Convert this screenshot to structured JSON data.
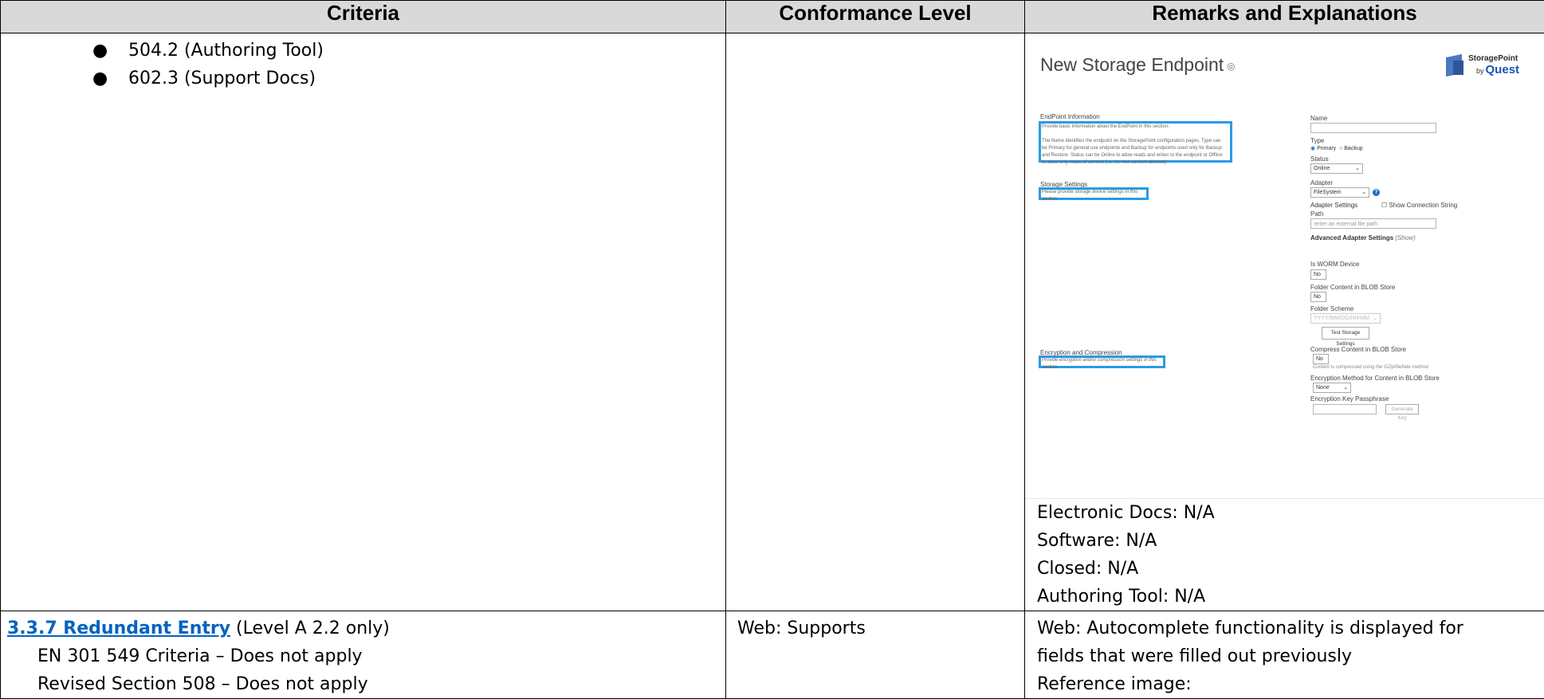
{
  "headers": {
    "criteria": "Criteria",
    "conformance": "Conformance Level",
    "remarks": "Remarks and Explanations"
  },
  "row1": {
    "criteria_items": [
      "504.2 (Authoring Tool)",
      "602.3 (Support Docs)"
    ],
    "conformance": "",
    "screenshot": {
      "title": "New Storage Endpoint",
      "title_info_icon": "info-icon",
      "logo": {
        "line1": "StoragePoint",
        "by": "by",
        "line2": "Quest"
      },
      "endpoint_info": {
        "heading": "EndPoint Information",
        "desc1": "Provide basic information about the EndPoint in this section.",
        "desc2": "The Name identifies the endpoint on the StoragePoint configuration pages. Type can be Primary for general use endpoints and Backup for endpoints used only for Backup and Restore. Status can be Online to allow reads and writes to the endpoint or Offline to allow only reads of content (i.e. no new content allowed)."
      },
      "storage_settings": {
        "heading": "Storage Settings",
        "desc": "Please provide storage device settings in this section."
      },
      "encryption": {
        "heading": "Encryption and Compression",
        "desc": "Provide encryption and/or compression settings in this section."
      },
      "form": {
        "name_label": "Name",
        "type_label": "Type",
        "type_primary": "Primary",
        "type_backup": "Backup",
        "status_label": "Status",
        "status_value": "Online",
        "adapter_label": "Adapter",
        "adapter_value": "FileSystem",
        "adapter_settings_label": "Adapter Settings",
        "show_conn": "Show Connection String",
        "path_label": "Path",
        "path_placeholder": "enter an external file path",
        "advanced_label": "Advanced Adapter Settings",
        "advanced_show": "(Show)",
        "worm_label": "Is WORM Device",
        "worm_value": "No",
        "folder_content_label": "Folder Content in BLOB Store",
        "folder_content_value": "No",
        "folder_scheme_label": "Folder Scheme",
        "folder_scheme_value": "YYYY/MM/DD/HH/MM",
        "test_button": "Test Storage Settings",
        "compress_label": "Compress Content in BLOB Store",
        "compress_value": "No",
        "compress_note": "Content is compressed using the GZip/Deflate method.",
        "enc_method_label": "Encryption Method for Content in BLOB Store",
        "enc_method_value": "None",
        "enc_key_label": "Encryption Key Passphrase",
        "generate_key": "Generate Key"
      }
    },
    "remarks_lines": [
      "Electronic Docs: N/A",
      "Software: N/A",
      "Closed: N/A",
      "Authoring Tool: N/A"
    ]
  },
  "row2": {
    "link_text": "3.3.7 Redundant Entry",
    "link_suffix": " (Level A 2.2 only)",
    "sub_lines": [
      "EN 301 549 Criteria – Does not apply",
      "Revised Section 508 – Does not apply"
    ],
    "conformance": "Web: Supports",
    "remarks_lines": [
      "Web: Autocomplete functionality is displayed for",
      "fields that were filled out previously",
      "Reference image:"
    ]
  },
  "colors": {
    "header_bg": "#d9d9d9",
    "link": "#0563c1",
    "highlight": "#2b9ae6"
  }
}
